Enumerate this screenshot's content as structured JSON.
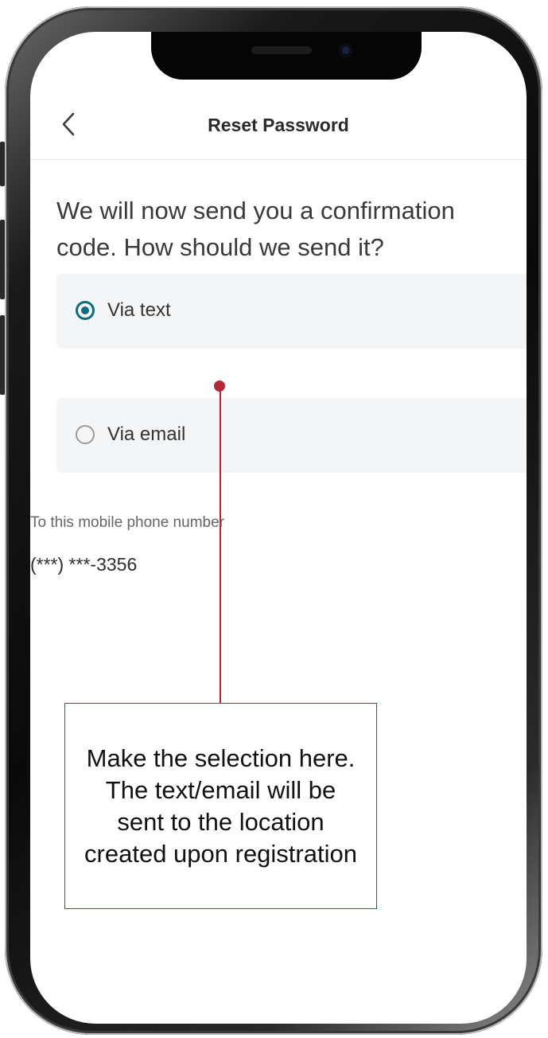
{
  "nav": {
    "back_icon": "chevron-left-icon",
    "title": "Reset Password"
  },
  "prompt": {
    "heading": "We will now send you a confirmation code. How should we send it?"
  },
  "options": [
    {
      "label": "Via text",
      "selected": true
    },
    {
      "label": "Via email",
      "selected": false
    }
  ],
  "destination": {
    "label": "To this mobile phone number",
    "value": "(***) ***-3356"
  },
  "annotation": {
    "text": "Make the selection here. The text/email will be sent to the location created upon registration"
  },
  "colors": {
    "accent": "#0d6e7a",
    "annotation": "#b22a35"
  }
}
